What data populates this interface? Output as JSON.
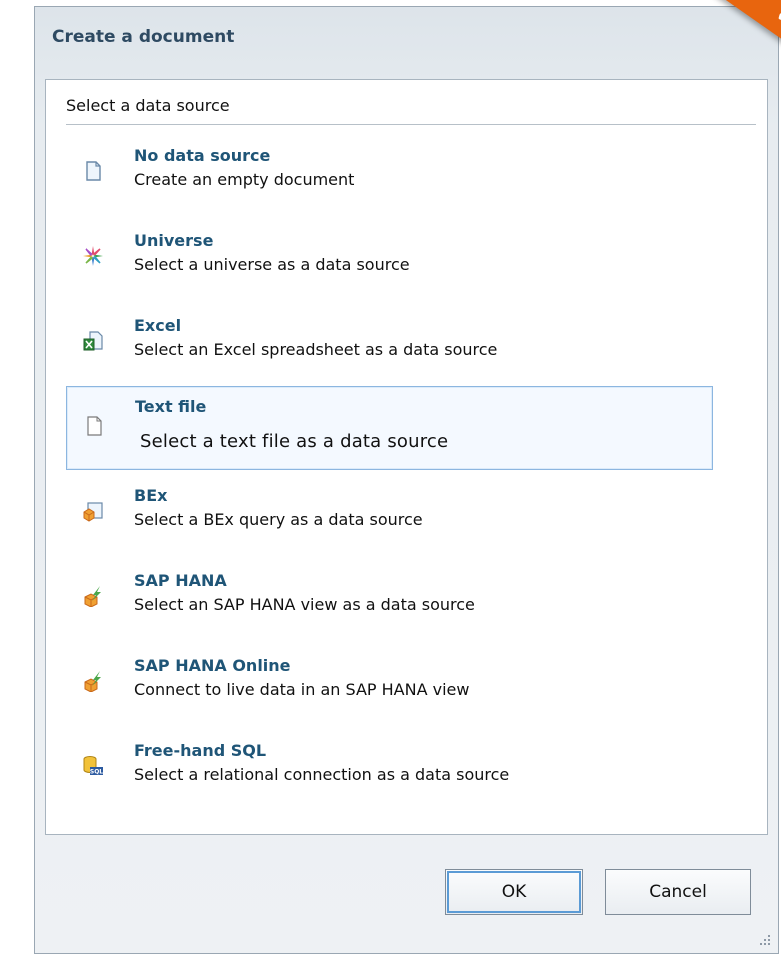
{
  "dialog": {
    "title": "Create a document",
    "panel_title": "Select a data source",
    "items": [
      {
        "name": "No data source",
        "desc": "Create an empty document",
        "icon": "blank-document-icon"
      },
      {
        "name": "Universe",
        "desc": "Select a universe as a data source",
        "icon": "universe-icon"
      },
      {
        "name": "Excel",
        "desc": "Select an Excel spreadsheet as a data source",
        "icon": "excel-icon"
      },
      {
        "name": "Text file",
        "desc": "Select a text file as a data source",
        "icon": "text-file-icon"
      },
      {
        "name": "BEx",
        "desc": "Select a BEx query as a data source",
        "icon": "bex-icon"
      },
      {
        "name": "SAP HANA",
        "desc": "Select an SAP HANA view as a data source",
        "icon": "sap-hana-icon"
      },
      {
        "name": "SAP HANA Online",
        "desc": "Connect to live data in an SAP HANA view",
        "icon": "sap-hana-online-icon"
      },
      {
        "name": "Free-hand SQL",
        "desc": "Select a relational connection as a data source",
        "icon": "sql-database-icon"
      }
    ],
    "selected": "Text file",
    "ok_label": "OK",
    "cancel_label": "Cancel",
    "accent_color": "#e8650e"
  }
}
